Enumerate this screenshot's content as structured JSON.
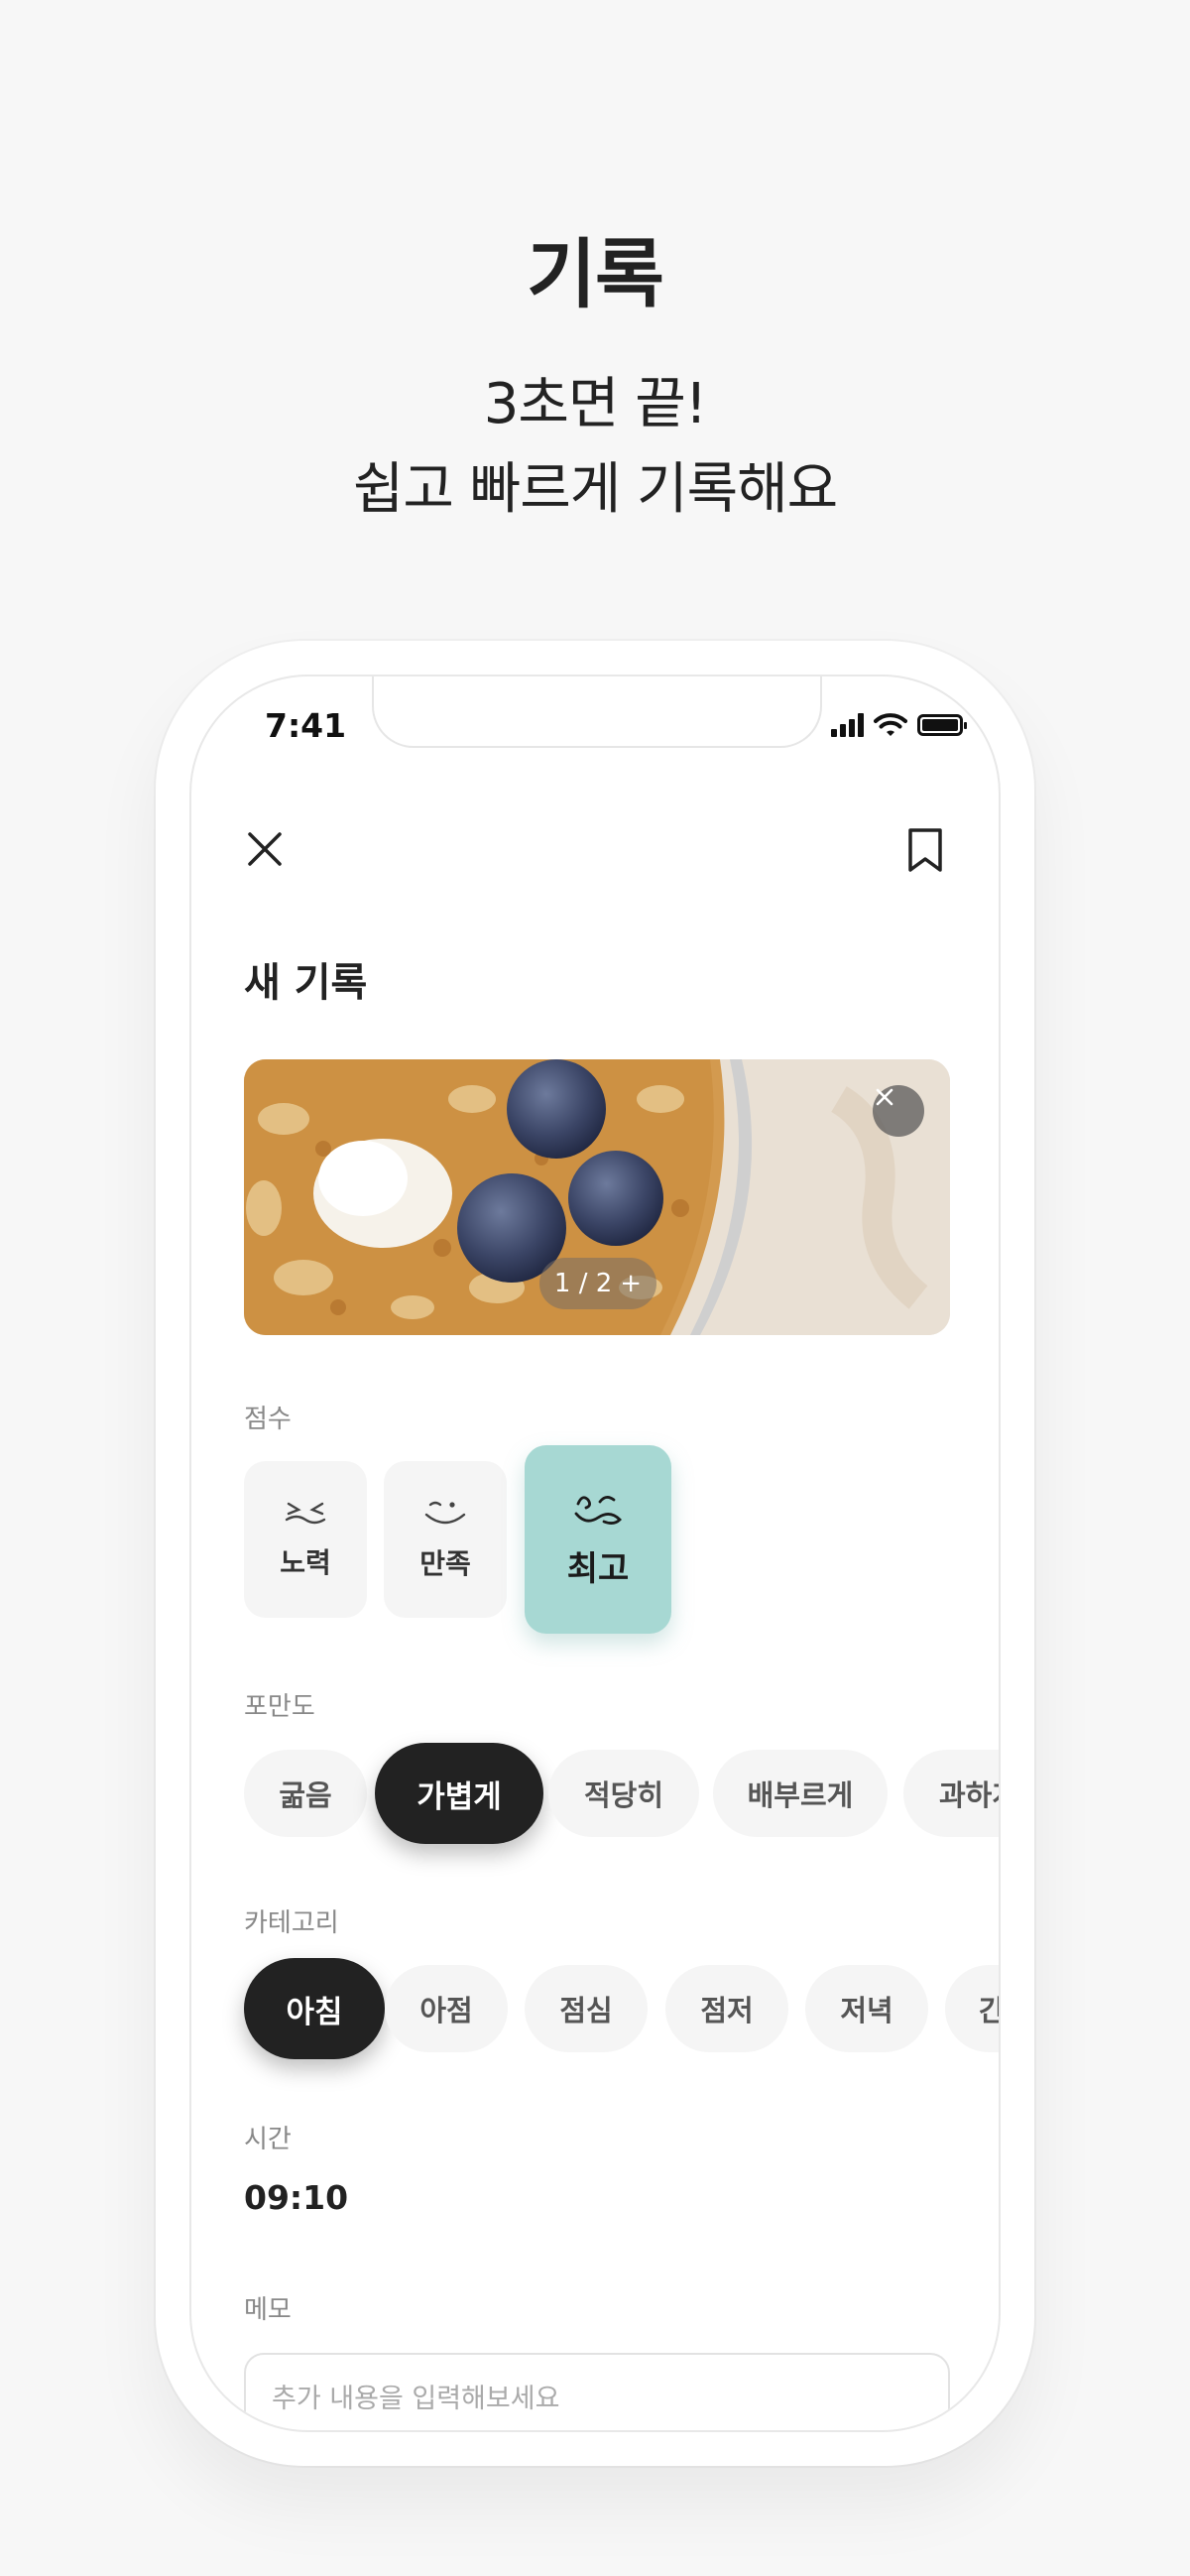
{
  "hero": {
    "title": "기록",
    "subtitle_line1": "3초면 끝!",
    "subtitle_line2": "쉽고 빠르게 기록해요"
  },
  "status_bar": {
    "time": "7:41",
    "icons": [
      "signal-icon",
      "wifi-icon",
      "battery-icon"
    ]
  },
  "header": {
    "close_icon": "close-icon",
    "bookmark_icon": "bookmark-icon"
  },
  "page_title": "새 기록",
  "photo": {
    "counter_current": "1 / 2",
    "counter_add": "+",
    "remove_icon": "close-icon"
  },
  "score": {
    "label": "점수",
    "options": [
      {
        "label": "노력",
        "icon": "effort-face-icon",
        "selected": false
      },
      {
        "label": "만족",
        "icon": "satisfied-face-icon",
        "selected": false
      },
      {
        "label": "최고",
        "icon": "best-face-icon",
        "selected": true
      }
    ],
    "accent_color": "#a7d8d3"
  },
  "fullness": {
    "label": "포만도",
    "options": [
      "굶음",
      "가볍게",
      "적당히",
      "배부르게",
      "과하게"
    ],
    "selected": "가볍게"
  },
  "category": {
    "label": "카테고리",
    "options": [
      "아침",
      "아점",
      "점심",
      "점저",
      "저녁",
      "간식"
    ],
    "selected": "아침"
  },
  "time": {
    "label": "시간",
    "value": "09:10"
  },
  "memo": {
    "label": "메모",
    "placeholder": "추가 내용을 입력해보세요"
  }
}
